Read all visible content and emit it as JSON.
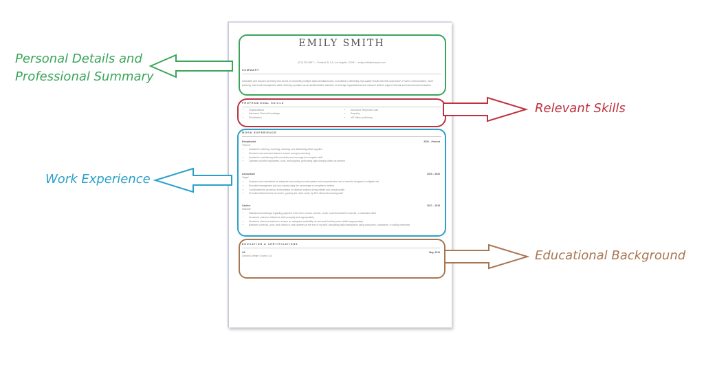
{
  "resume": {
    "name": "EMILY SMITH",
    "contact": "(213) 323-8567  —  Portland St, CA, Los Angeles 12345  —  emily.smith@example.com",
    "summary": {
      "title": "SUMMARY",
      "text": "Dedicated and focused secretary who excels in completing multiple tasks simultaneously. Committed to delivering high-quality results with little supervision. Proven communication, travel planning, and email management skills. Seeking a position as an administrative assistant, to leverage organizational and research skills to support internal and external communication."
    },
    "skills": {
      "title": "PROFESSIONAL SKILLS",
      "left": [
        "Organizational",
        "Advanced Clerical Knowledge",
        "Prioritization"
      ],
      "right": [
        "Advanced Telephone Calls",
        "Empathy",
        "MS Office proficiency"
      ]
    },
    "experience": {
      "title": "WORK EXPERIENCE",
      "jobs": [
        {
          "title": "Receptionist",
          "company": "Yelp Inc.",
          "dates": "2020 – Present",
          "bullets": [
            "Assisted in ordering, receiving, stocking, and distributing office supplies",
            "Received and scanned claims to ensure prompt processing",
            "Assisted in maintaining shift schedules and coverage for reception staff",
            "Operated all office equipment, tools, and supplies, performing light cleaning duties as needed"
          ]
        },
        {
          "title": "Accountant",
          "company": "Target",
          "dates": "2019 – 2020",
          "bullets": [
            "Analyzed and maintained an adequate accounting records system and comprehensive set of controls designed to mitigate risk",
            "Provided management job cost reports using the percentage of completion method",
            "Coordinated the provision of information to external auditors during interim and annual audits",
            "Provided efficient levels of service, growing the client roster by 35% without increasing staff"
          ]
        },
        {
          "title": "Cashier",
          "company": "Walmart",
          "dates": "2017 – 2019",
          "bullets": [
            "Maintained knowledge regarding payment in the form of cash, checks, credit, vouchers/traveler's checks, or automatic debit",
            "Answered customer telephone calls promptly and appropriately",
            "Monitored checkout stations to ensure an adequate availability of cash and that they were staffed appropriately",
            "Balanced currency, coins, and checks in cash drawers at the end of my shift, calculating daily transactions using computers, calculators, or adding machines"
          ]
        }
      ]
    },
    "education": {
      "title": "EDUCATION & CERTIFICATIONS",
      "degree": "AS",
      "school": "Oxnard College, Oxnard, CA",
      "date": "May, 2019"
    }
  },
  "callouts": {
    "personal": {
      "line1": "Personal Details and",
      "line2": "Professional Summary",
      "color": "#3aa45a"
    },
    "skills": {
      "label": "Relevant Skills",
      "color": "#c0313f"
    },
    "experience": {
      "label": "Work Experience",
      "color": "#2aa0c8"
    },
    "education": {
      "label": "Educational Background",
      "color": "#a97652"
    }
  }
}
